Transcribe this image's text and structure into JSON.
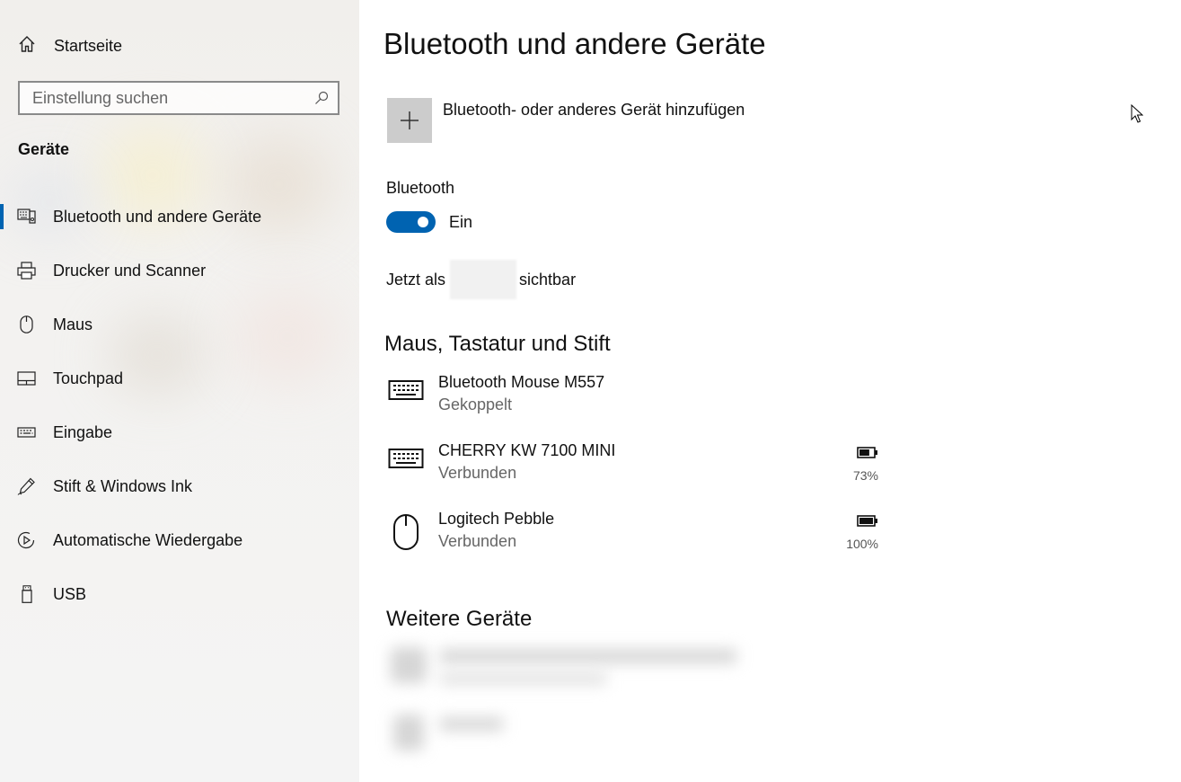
{
  "sidebar": {
    "home_label": "Startseite",
    "search_placeholder": "Einstellung suchen",
    "section_title": "Geräte",
    "items": [
      {
        "label": "Bluetooth und andere Geräte",
        "icon": "bluetooth-devices-icon",
        "active": true
      },
      {
        "label": "Drucker und Scanner",
        "icon": "printer-icon"
      },
      {
        "label": "Maus",
        "icon": "mouse-icon"
      },
      {
        "label": "Touchpad",
        "icon": "touchpad-icon"
      },
      {
        "label": "Eingabe",
        "icon": "keyboard-icon"
      },
      {
        "label": "Stift & Windows Ink",
        "icon": "pen-icon"
      },
      {
        "label": "Automatische Wiedergabe",
        "icon": "autoplay-icon"
      },
      {
        "label": "USB",
        "icon": "usb-icon"
      }
    ]
  },
  "main": {
    "title": "Bluetooth und andere Geräte",
    "add_device_label": "Bluetooth- oder anderes Gerät hinzufügen",
    "bluetooth_label": "Bluetooth",
    "toggle_state": "Ein",
    "visible_prefix": "Jetzt als",
    "visible_suffix": "sichtbar",
    "section_input": "Maus, Tastatur und Stift",
    "devices": [
      {
        "name": "Bluetooth Mouse M557",
        "status": "Gekoppelt",
        "icon": "keyboard-icon"
      },
      {
        "name": "CHERRY KW 7100 MINI",
        "status": "Verbunden",
        "icon": "keyboard-icon",
        "battery": "73%",
        "battery_level": 0.73
      },
      {
        "name": "Logitech Pebble",
        "status": "Verbunden",
        "icon": "mouse-icon",
        "battery": "100%",
        "battery_level": 1.0
      }
    ],
    "section_other": "Weitere Geräte"
  },
  "colors": {
    "accent": "#0063b1",
    "add_button_bg": "#cccccc",
    "secondary_text": "#666666"
  }
}
